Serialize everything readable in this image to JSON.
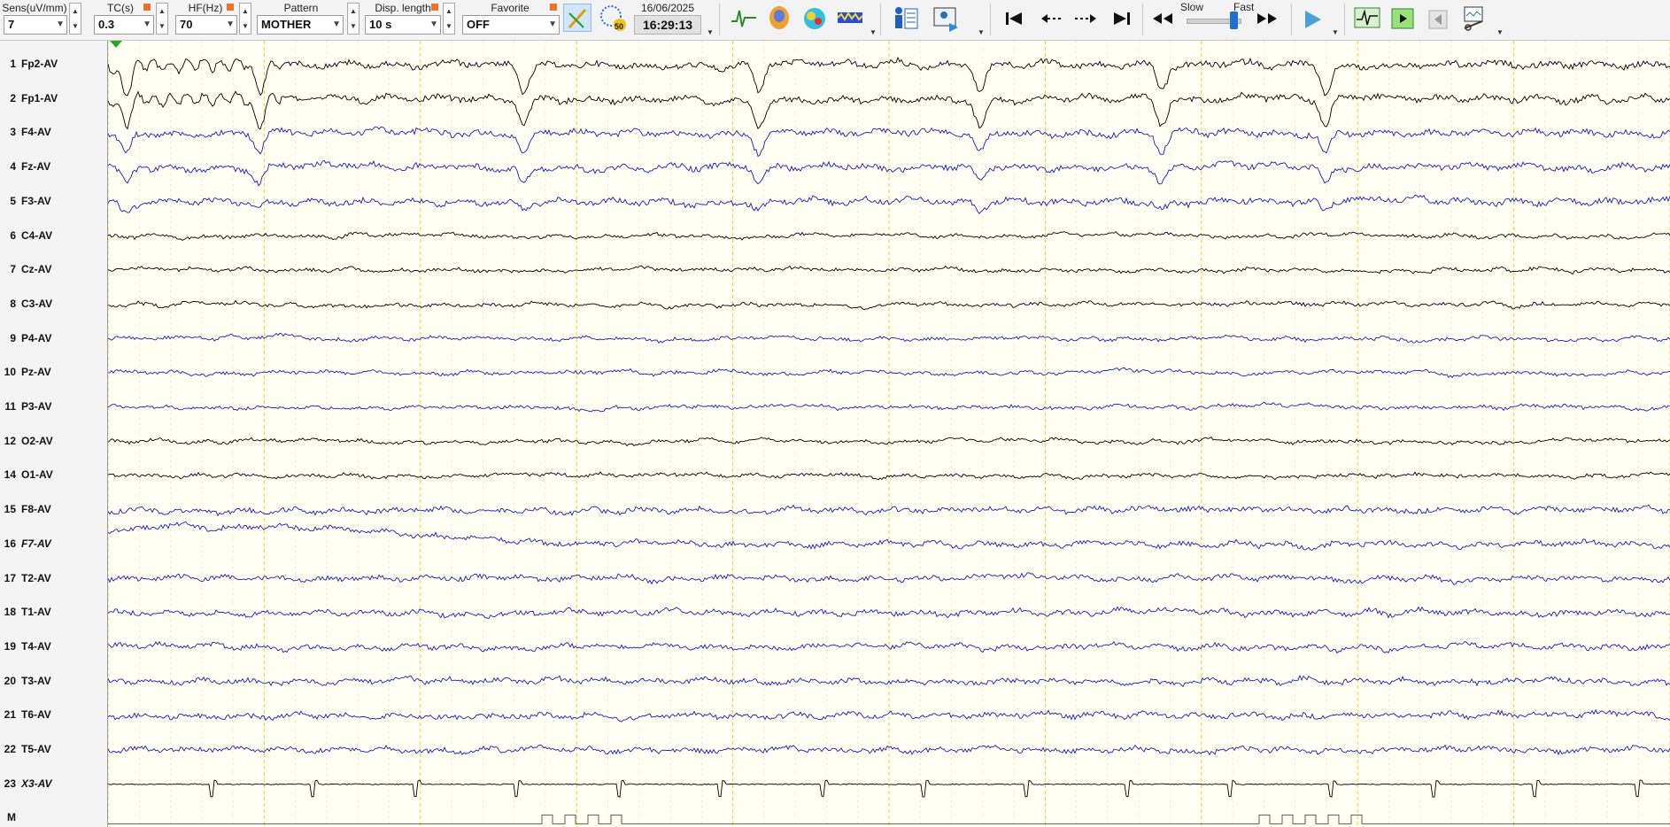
{
  "toolbar": {
    "sensitivity": {
      "label": "Sens(uV/mm)",
      "value": "7"
    },
    "time_constant": {
      "label": "TC(s)",
      "value": "0.3"
    },
    "high_filter": {
      "label": "HF(Hz)",
      "value": "70"
    },
    "pattern": {
      "label": "Pattern",
      "value": "MOTHER"
    },
    "display_length": {
      "label": "Disp. length",
      "value": "10 s"
    },
    "favorite": {
      "label": "Favorite",
      "value": "OFF"
    },
    "date": "16/06/2025",
    "time": "16:29:13",
    "speed": {
      "slow_label": "Slow",
      "fast_label": "Fast"
    },
    "hz_badge": "50"
  },
  "channels": [
    {
      "num": "1",
      "name": "Fp2-AV",
      "color": "#000000",
      "italic": false
    },
    {
      "num": "2",
      "name": "Fp1-AV",
      "color": "#000000",
      "italic": false
    },
    {
      "num": "3",
      "name": "F4-AV",
      "color": "#1a1ab8",
      "italic": false
    },
    {
      "num": "4",
      "name": "Fz-AV",
      "color": "#1a1ab8",
      "italic": false
    },
    {
      "num": "5",
      "name": "F3-AV",
      "color": "#1a1ab8",
      "italic": false
    },
    {
      "num": "6",
      "name": "C4-AV",
      "color": "#000000",
      "italic": false
    },
    {
      "num": "7",
      "name": "Cz-AV",
      "color": "#000000",
      "italic": false
    },
    {
      "num": "8",
      "name": "C3-AV",
      "color": "#000000",
      "italic": false
    },
    {
      "num": "9",
      "name": "P4-AV",
      "color": "#1a1ab8",
      "italic": false
    },
    {
      "num": "10",
      "name": "Pz-AV",
      "color": "#1a1ab8",
      "italic": false
    },
    {
      "num": "11",
      "name": "P3-AV",
      "color": "#1a1ab8",
      "italic": false
    },
    {
      "num": "12",
      "name": "O2-AV",
      "color": "#000000",
      "italic": false
    },
    {
      "num": "14",
      "name": "O1-AV",
      "color": "#000000",
      "italic": false
    },
    {
      "num": "15",
      "name": "F8-AV",
      "color": "#1a1ab8",
      "italic": false
    },
    {
      "num": "16",
      "name": "F7-AV",
      "color": "#1a1ab8",
      "italic": true
    },
    {
      "num": "17",
      "name": "T2-AV",
      "color": "#1a1ab8",
      "italic": false
    },
    {
      "num": "18",
      "name": "T1-AV",
      "color": "#1a1ab8",
      "italic": false
    },
    {
      "num": "19",
      "name": "T4-AV",
      "color": "#1a1ab8",
      "italic": false
    },
    {
      "num": "20",
      "name": "T3-AV",
      "color": "#1a1ab8",
      "italic": false
    },
    {
      "num": "21",
      "name": "T6-AV",
      "color": "#1a1ab8",
      "italic": false
    },
    {
      "num": "22",
      "name": "T5-AV",
      "color": "#1a1ab8",
      "italic": false
    },
    {
      "num": "23",
      "name": "X3-AV",
      "color": "#000000",
      "italic": true
    },
    {
      "num": "M",
      "name": "",
      "color": "#000000",
      "italic": false
    }
  ],
  "colors": {
    "plot_background": "#fffef3",
    "second_gridline": "#e8d43a",
    "sub_gridline": "#d8d8c8",
    "black_trace": "#000000",
    "blue_trace": "#1a1ab8",
    "event_marker": "#22aa22"
  },
  "icons": [
    "spike-icon",
    "head-map-icon",
    "topography-icon",
    "spectrum-icon",
    "patient-info-icon",
    "video-icon",
    "go-start-icon",
    "page-back-icon",
    "page-forward-icon",
    "go-end-icon",
    "rewind-icon",
    "fast-forward-icon",
    "play-icon",
    "signal-monitor-icon",
    "play-green-icon",
    "stop-icon",
    "settings-tools-icon"
  ]
}
